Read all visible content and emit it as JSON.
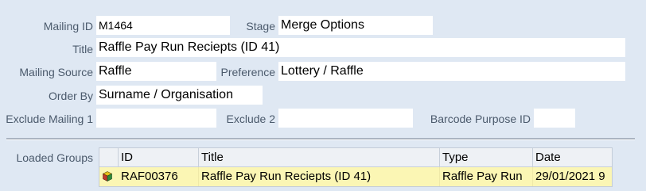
{
  "form": {
    "mailing_id_label": "Mailing ID",
    "mailing_id_value": "M1464",
    "stage_label": "Stage",
    "stage_value": "Merge Options",
    "title_label": "Title",
    "title_value": "Raffle Pay Run Reciepts (ID 41)",
    "mailing_source_label": "Mailing Source",
    "mailing_source_value": "Raffle",
    "preference_label": "Preference",
    "preference_value": "Lottery / Raffle",
    "order_by_label": "Order By",
    "order_by_value": "Surname / Organisation",
    "exclude_mailing_1_label": "Exclude Mailing 1",
    "exclude_mailing_1_value": "",
    "exclude_2_label": "Exclude 2",
    "exclude_2_value": "",
    "barcode_purpose_label": "Barcode Purpose ID",
    "barcode_purpose_value": ""
  },
  "loaded_groups": {
    "label": "Loaded Groups",
    "columns": [
      "ID",
      "Title",
      "Type",
      "Date"
    ],
    "rows": [
      {
        "icon": "group-cube-icon",
        "id": "RAF00376",
        "title": "Raffle Pay Run Reciepts (ID 41)",
        "type": "Raffle Pay Run",
        "date": "29/01/2021 9"
      }
    ]
  },
  "colors": {
    "background": "#dfe8f3",
    "field": "#ffffff",
    "selected_row": "#fbf6b4"
  }
}
